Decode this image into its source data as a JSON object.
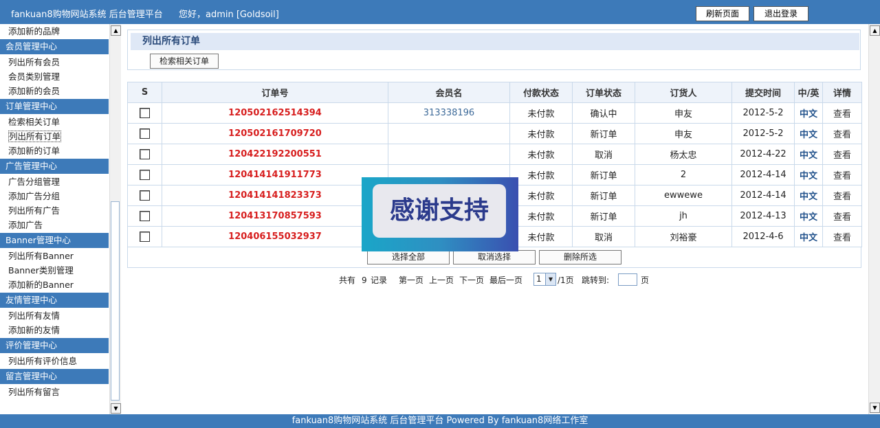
{
  "header": {
    "title": "fankuan8购物网站系统  后台管理平台",
    "welcome": "您好，admin [Goldsoil]",
    "refresh_label": "刷新页面",
    "logout_label": "退出登录"
  },
  "sidebar": {
    "items": [
      {
        "type": "item",
        "label": "添加新的品牌"
      },
      {
        "type": "head",
        "label": "会员管理中心"
      },
      {
        "type": "item",
        "label": "列出所有会员"
      },
      {
        "type": "item",
        "label": "会员类别管理"
      },
      {
        "type": "item",
        "label": "添加新的会员"
      },
      {
        "type": "head",
        "label": "订单管理中心"
      },
      {
        "type": "item",
        "label": "检索相关订单"
      },
      {
        "type": "item",
        "label": "列出所有订单",
        "selected": true
      },
      {
        "type": "item",
        "label": "添加新的订单"
      },
      {
        "type": "head",
        "label": "广告管理中心"
      },
      {
        "type": "item",
        "label": "广告分组管理"
      },
      {
        "type": "item",
        "label": "添加广告分组"
      },
      {
        "type": "item",
        "label": "列出所有广告"
      },
      {
        "type": "item",
        "label": "添加广告"
      },
      {
        "type": "head",
        "label": "Banner管理中心"
      },
      {
        "type": "item",
        "label": "列出所有Banner"
      },
      {
        "type": "item",
        "label": "Banner类别管理"
      },
      {
        "type": "item",
        "label": "添加新的Banner"
      },
      {
        "type": "head",
        "label": "友情管理中心"
      },
      {
        "type": "item",
        "label": "列出所有友情"
      },
      {
        "type": "item",
        "label": "添加新的友情"
      },
      {
        "type": "head",
        "label": "评价管理中心"
      },
      {
        "type": "item",
        "label": "列出所有评价信息"
      },
      {
        "type": "head",
        "label": "留言管理中心"
      },
      {
        "type": "item",
        "label": "列出所有留言"
      }
    ]
  },
  "panel": {
    "title": "列出所有订单",
    "search_label": "检索相关订单"
  },
  "table": {
    "headers": [
      "S",
      "订单号",
      "会员名",
      "付款状态",
      "订单状态",
      "订货人",
      "提交时间",
      "中/英",
      "详情"
    ],
    "rows": [
      {
        "order_no": "120502162514394",
        "member": "313338196",
        "pay": "未付款",
        "status": "确认中",
        "buyer": "申友",
        "time": "2012-5-2",
        "lang": "中文",
        "view": "查看"
      },
      {
        "order_no": "120502161709720",
        "member": "",
        "pay": "未付款",
        "status": "新订单",
        "buyer": "申友",
        "time": "2012-5-2",
        "lang": "中文",
        "view": "查看"
      },
      {
        "order_no": "120422192200551",
        "member": "",
        "pay": "未付款",
        "status": "取消",
        "buyer": "杨太忠",
        "time": "2012-4-22",
        "lang": "中文",
        "view": "查看"
      },
      {
        "order_no": "120414141911773",
        "member": "",
        "pay": "未付款",
        "status": "新订单",
        "buyer": "2",
        "time": "2012-4-14",
        "lang": "中文",
        "view": "查看"
      },
      {
        "order_no": "120414141823373",
        "member": "",
        "pay": "未付款",
        "status": "新订单",
        "buyer": "ewwewe",
        "time": "2012-4-14",
        "lang": "中文",
        "view": "查看"
      },
      {
        "order_no": "120413170857593",
        "member": "",
        "pay": "未付款",
        "status": "新订单",
        "buyer": "jh",
        "time": "2012-4-13",
        "lang": "中文",
        "view": "查看"
      },
      {
        "order_no": "120406155032937",
        "member": "",
        "pay": "未付款",
        "status": "取消",
        "buyer": "刘裕豪",
        "time": "2012-4-6",
        "lang": "中文",
        "view": "查看"
      }
    ],
    "select_all_label": "选择全部",
    "deselect_label": "取消选择",
    "delete_label": "删除所选"
  },
  "pager": {
    "total_prefix": "共有",
    "total_count": "9",
    "total_suffix": "记录",
    "first": "第一页",
    "prev": "上一页",
    "next": "下一页",
    "last": "最后一页",
    "current_page": "1",
    "page_total": "/1页",
    "jump_label": "跳转到:",
    "page_unit": "页"
  },
  "overlay": {
    "text": "感谢支持"
  },
  "footer": {
    "text": "fankuan8购物网站系统  后台管理平台    Powered By fankuan8网络工作室"
  }
}
